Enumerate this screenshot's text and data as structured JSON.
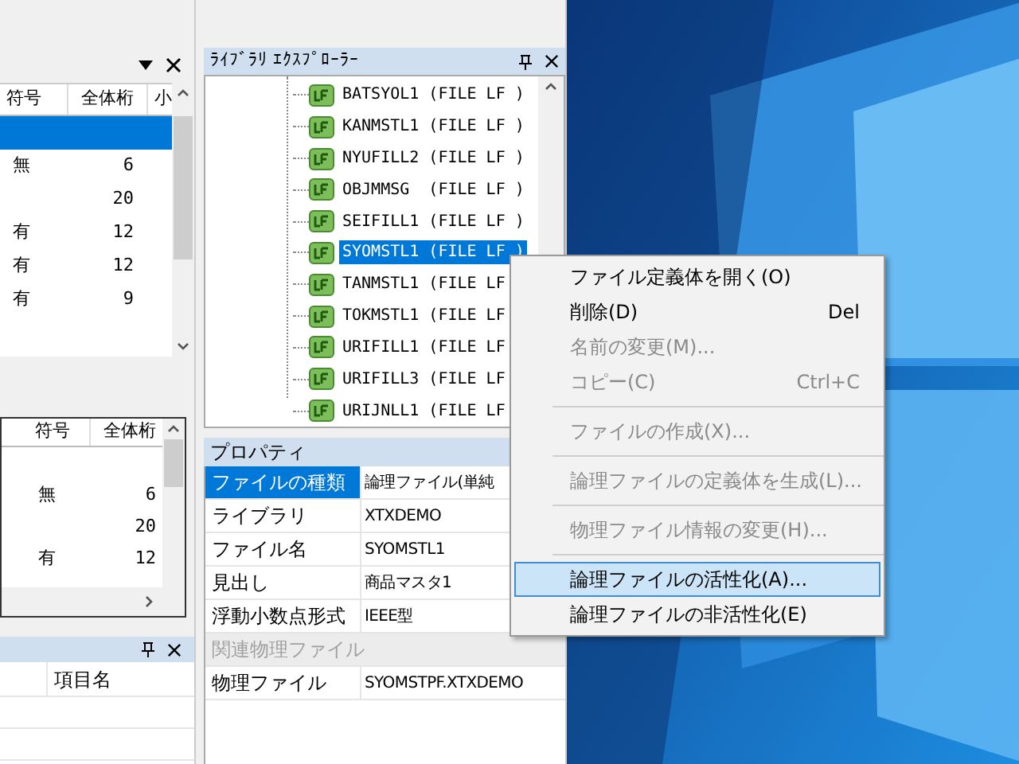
{
  "left_top_panel": {
    "columns": [
      "符号",
      "全体桁",
      "小"
    ],
    "rows": [
      {
        "selected": true,
        "cells": [
          "",
          ""
        ]
      },
      {
        "selected": false,
        "cells": [
          "無",
          "6"
        ]
      },
      {
        "selected": false,
        "cells": [
          "",
          "20"
        ]
      },
      {
        "selected": false,
        "cells": [
          "有",
          "12"
        ]
      },
      {
        "selected": false,
        "cells": [
          "有",
          "12"
        ]
      },
      {
        "selected": false,
        "cells": [
          "有",
          "9"
        ]
      }
    ]
  },
  "left_middle_panel": {
    "columns": [
      "符号",
      "全体桁"
    ],
    "rows": [
      [
        "",
        ""
      ],
      [
        "無",
        "6"
      ],
      [
        "",
        "20"
      ],
      [
        "有",
        "12"
      ]
    ]
  },
  "left_bottom_panel": {
    "columns": [
      "項目名"
    ]
  },
  "library_explorer": {
    "title": "ﾗｲﾌﾞﾗﾘ ｴｸｽﾌﾟﾛｰﾗｰ",
    "items": [
      {
        "label": "BATSYOL1 (FILE LF )",
        "selected": false
      },
      {
        "label": "KANMSTL1 (FILE LF )",
        "selected": false
      },
      {
        "label": "NYUFILL2 (FILE LF )",
        "selected": false
      },
      {
        "label": "OBJMMSG  (FILE LF )",
        "selected": false
      },
      {
        "label": "SEIFILL1 (FILE LF )",
        "selected": false
      },
      {
        "label": "SYOMSTL1 (FILE LF )",
        "selected": true
      },
      {
        "label": "TANMSTL1 (FILE LF",
        "selected": false
      },
      {
        "label": "TOKMSTL1 (FILE LF",
        "selected": false
      },
      {
        "label": "URIFILL1 (FILE LF",
        "selected": false
      },
      {
        "label": "URIFILL3 (FILE LF",
        "selected": false
      },
      {
        "label": "URIJNLL1 (FILE LF",
        "selected": false
      }
    ]
  },
  "properties": {
    "title": "プロパティ",
    "rows": [
      {
        "kind": "property",
        "name": "ファイルの種類",
        "value": "論理ファイル(単純",
        "selected": true
      },
      {
        "kind": "property",
        "name": "ライブラリ",
        "value": "XTXDEMO",
        "selected": false
      },
      {
        "kind": "property",
        "name": "ファイル名",
        "value": "SYOMSTL1",
        "selected": false
      },
      {
        "kind": "property",
        "name": "見出し",
        "value": "商品マスタ1",
        "selected": false
      },
      {
        "kind": "property",
        "name": "浮動小数点形式",
        "value": "IEEE型",
        "selected": false
      },
      {
        "kind": "category",
        "name": "関連物理ファイル"
      },
      {
        "kind": "property",
        "name": "物理ファイル",
        "value": "SYOMSTPF.XTXDEMO",
        "selected": false
      }
    ]
  },
  "context_menu": [
    {
      "kind": "item",
      "label": "ファイル定義体を開く(O)",
      "disabled": false,
      "selected": false
    },
    {
      "kind": "item",
      "label": "削除(D)",
      "shortcut": "Del",
      "disabled": false,
      "selected": false
    },
    {
      "kind": "item",
      "label": "名前の変更(M)...",
      "disabled": true,
      "selected": false
    },
    {
      "kind": "item",
      "label": "コピー(C)",
      "shortcut": "Ctrl+C",
      "disabled": true,
      "selected": false
    },
    {
      "kind": "separator"
    },
    {
      "kind": "item",
      "label": "ファイルの作成(X)...",
      "disabled": true,
      "selected": false
    },
    {
      "kind": "separator"
    },
    {
      "kind": "item",
      "label": "論理ファイルの定義体を生成(L)...",
      "disabled": true,
      "selected": false
    },
    {
      "kind": "separator"
    },
    {
      "kind": "item",
      "label": "物理ファイル情報の変更(H)...",
      "disabled": true,
      "selected": false
    },
    {
      "kind": "separator"
    },
    {
      "kind": "item",
      "label": "論理ファイルの活性化(A)...",
      "disabled": false,
      "selected": true
    },
    {
      "kind": "item",
      "label": "論理ファイルの非活性化(E)",
      "disabled": false,
      "selected": false
    }
  ]
}
